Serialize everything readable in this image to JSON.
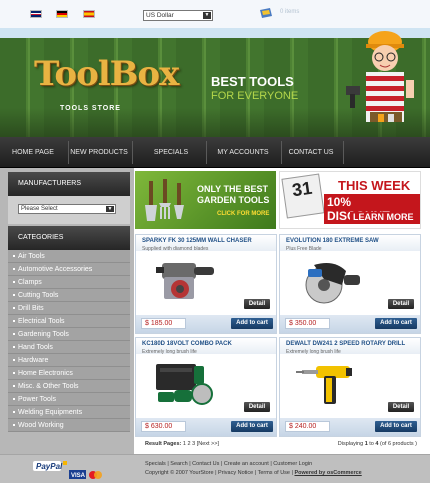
{
  "topbar": {
    "languages": [
      "english-flag",
      "german-flag",
      "spanish-flag"
    ],
    "currency_value": "US Dollar",
    "cart_text_line1": "",
    "cart_text_line2": "0 items"
  },
  "header": {
    "logo": "ToolBox",
    "logo_subtitle": "TOOLS STORE",
    "slogan_line1": "BEST TOOLS",
    "slogan_line2": "FOR EVERYONE"
  },
  "nav": {
    "items": [
      "HOME PAGE",
      "NEW PRODUCTS",
      "SPECIALS",
      "MY ACCOUNTS",
      "CONTACT US"
    ]
  },
  "sidebar": {
    "manufacturers_title": "MANUFACTURERS",
    "manufacturers_select": "Please Select",
    "categories_title": "CATEGORIES",
    "categories": [
      "Air Tools",
      "Automotive Accessories",
      "Clamps",
      "Cutting Tools",
      "Drill Bits",
      "Electrical Tools",
      "Gardening Tools",
      "Hand Tools",
      "Hardware",
      "Home Electronics",
      "Misc. & Other Tools",
      "Power Tools",
      "Welding Equipments",
      "Wood Working"
    ]
  },
  "promos": {
    "garden_line1": "ONLY THE BEST",
    "garden_line2": "GARDEN TOOLS",
    "garden_cta": "CLICK FOR MORE",
    "week_calendar": "31",
    "week_line1": "THIS WEEK",
    "week_line2": "10% DISCOUNT",
    "week_cta": "LEARN MORE"
  },
  "products": [
    {
      "title": "SPARKY FK 30 125MM WALL CHASER",
      "subtitle": "Supplied with diamond blades",
      "price": "$ 185.00",
      "detail": "Detail",
      "add": "Add to cart"
    },
    {
      "title": "EVOLUTION 180 EXTREME SAW",
      "subtitle": "Plus Free Blade",
      "price": "$ 350.00",
      "detail": "Detail",
      "add": "Add to cart"
    },
    {
      "title": "KC180D 18VOLT COMBO PACK",
      "subtitle": "Extremely long brush life",
      "price": "$ 630.00",
      "detail": "Detail",
      "add": "Add to cart"
    },
    {
      "title": "DEWALT DW241 2 SPEED ROTARY DRILL",
      "subtitle": "Extremely long brush life",
      "price": "$ 240.00",
      "detail": "Detail",
      "add": "Add to cart"
    }
  ],
  "pagination": {
    "label": "Result Pages:",
    "pages": [
      "1",
      "2",
      "3"
    ],
    "next": "[Next >>]",
    "displaying_prefix": "Displaying",
    "displaying_from": "1",
    "displaying_to": "4",
    "displaying_total": "(of 6 products )"
  },
  "footer": {
    "payment_logos": [
      "PayPal",
      "VISA",
      "MasterCard"
    ],
    "links": "Specials  |  Search  |  Contact Us  |  Create an account  |  Customer Login",
    "copyright": "Copyright © 2007 YourStore  |  Privacy Notice  |  Terms of Use  |",
    "powered": "Powered by osCommerce"
  },
  "colors": {
    "nav_bg": "#2a2a2a",
    "accent_blue": "#1f4f86",
    "price_red": "#b51f1f",
    "promo_red": "#c4161c",
    "garden_green": "#5f9a2a"
  }
}
